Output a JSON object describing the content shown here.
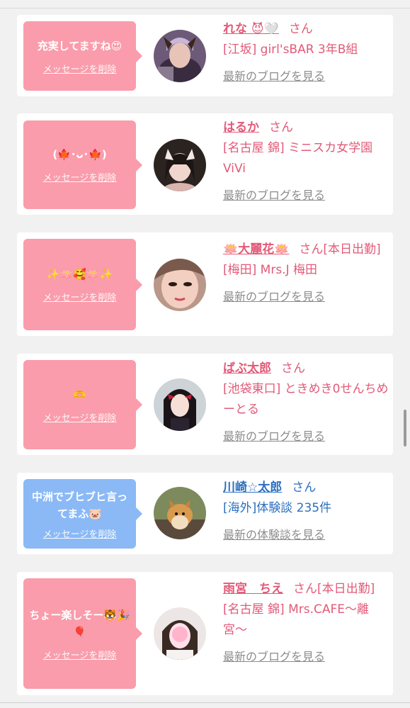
{
  "common": {
    "delete_label": "メッセージを削除",
    "san": "さん",
    "blog_link": "最新のブログを見る",
    "report_link": "最新の体験談を見る"
  },
  "cards": [
    {
      "message": "充実してますね😍",
      "name": "れな 😈🤍",
      "suffix": "さん",
      "shop": "[江坂] girl'sBAR 3年B組",
      "link": "最新のブログを見る"
    },
    {
      "message": "(🍁･ᴗ･🍁)",
      "name": "はるか",
      "suffix": "さん",
      "shop": "[名古屋 錦] ミニスカ女学園ViVi",
      "link": "最新のブログを見る"
    },
    {
      "message": "✨🪷🥰🪷✨",
      "name": "🪷大麗花🪷",
      "suffix": "さん[本日出勤]",
      "shop": "[梅田] Mrs.J 梅田",
      "link": "最新のブログを見る"
    },
    {
      "message": "🫶",
      "name": "ばぶ太郎",
      "suffix": "さん",
      "shop": "[池袋東口] ときめき0せんちめーとる",
      "link": "最新のブログを見る"
    },
    {
      "message": "中洲でブヒブヒ言ってまふ🐷",
      "name": "川崎☆太郎",
      "suffix": "さん",
      "shop": "[海外]体験談 235件",
      "link": "最新の体験談を見る"
    },
    {
      "message": "ちょー楽しそー🐯🎉🎈",
      "name": "雨宮　ちえ",
      "suffix": "さん[本日出勤]",
      "shop": "[名古屋 錦] Mrs.CAFE〜離宮〜",
      "link": "最新のブログを見る"
    }
  ],
  "colors": {
    "pink_bubble": "#fa9cab",
    "blue_bubble": "#8ab9f6",
    "pink_text": "#e25a78",
    "blue_text": "#2c6fc0",
    "link_gray": "#8c8c8c"
  }
}
